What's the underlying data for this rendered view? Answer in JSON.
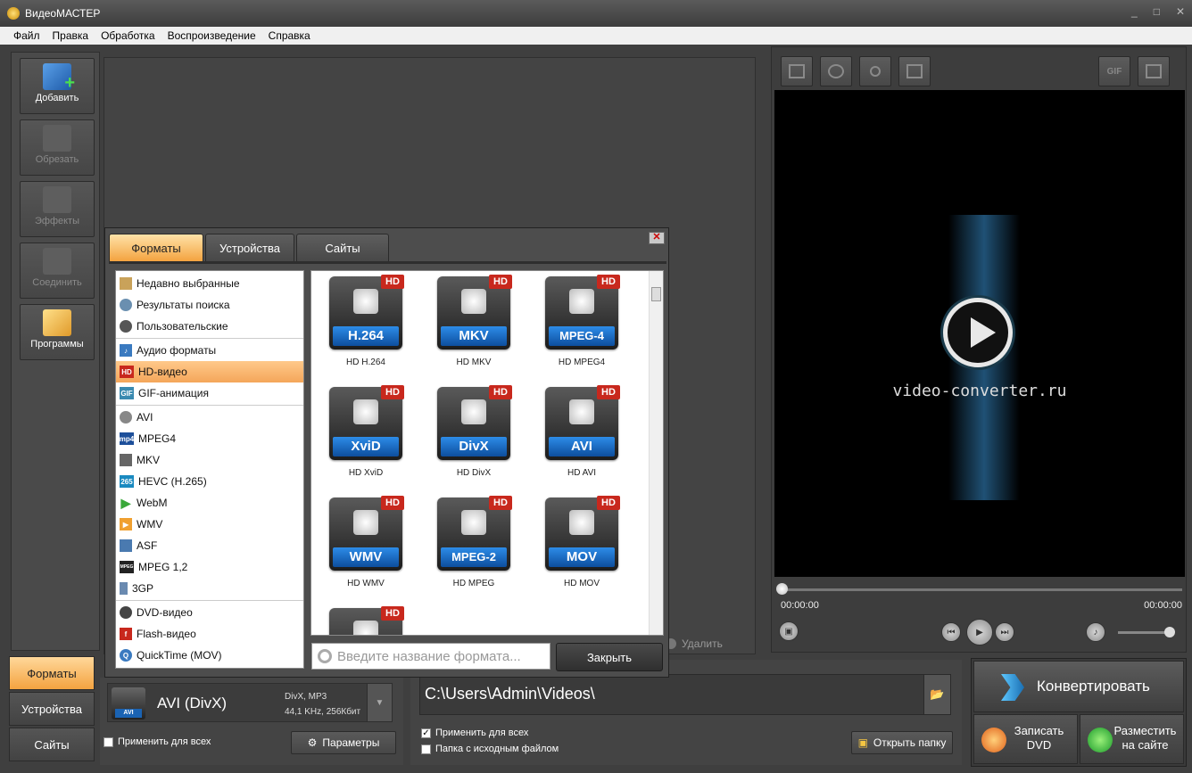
{
  "window": {
    "title": "ВидеоМАСТЕР",
    "min": "_",
    "max": "□",
    "close": "✕"
  },
  "menu": [
    "Файл",
    "Правка",
    "Обработка",
    "Воспроизведение",
    "Справка"
  ],
  "tools": [
    {
      "label": "Добавить",
      "icon": "film-add-icon"
    },
    {
      "label": "Обрезать",
      "icon": "scissors-icon"
    },
    {
      "label": "Эффекты",
      "icon": "effects-icon"
    },
    {
      "label": "Соединить",
      "icon": "join-icon"
    },
    {
      "label": "Программы",
      "icon": "programs-icon"
    }
  ],
  "workarea": {
    "delete_label": "Удалить"
  },
  "preview": {
    "gif_label": "GIF",
    "watermark": "video-converter.ru",
    "time_start": "00:00:00",
    "time_end": "00:00:00"
  },
  "bottom_tabs": [
    "Форматы",
    "Устройства",
    "Сайты"
  ],
  "format_panel": {
    "icon_label": "AVI",
    "name": "AVI (DivX)",
    "spec_line1": "DivX, MP3",
    "spec_line2": "44,1 KHz, 256Кбит",
    "apply_all": "Применить для всех",
    "params": "Параметры"
  },
  "output": {
    "path": "C:\\Users\\Admin\\Videos\\",
    "apply_all": "Применить для всех",
    "source_folder": "Папка с исходным файлом",
    "open_folder": "Открыть папку"
  },
  "convert": {
    "main": "Конвертировать",
    "dvd_line1": "Записать",
    "dvd_line2": "DVD",
    "site_line1": "Разместить",
    "site_line2": "на сайте"
  },
  "dialog": {
    "tabs": [
      "Форматы",
      "Устройства",
      "Сайты"
    ],
    "categories": [
      {
        "label": "Недавно выбранные",
        "icon": "recent-icon"
      },
      {
        "label": "Результаты поиска",
        "icon": "search-results-icon"
      },
      {
        "label": "Пользовательские",
        "icon": "user-icon"
      },
      {
        "label": "Аудио форматы",
        "icon": "audio-icon"
      },
      {
        "label": "HD-видео",
        "icon": "hd-icon",
        "badge": "HD"
      },
      {
        "label": "GIF-анимация",
        "icon": "gif-icon",
        "badge": "GIF"
      },
      {
        "label": "AVI",
        "icon": "avi-icon"
      },
      {
        "label": "MPEG4",
        "icon": "mp4-icon",
        "badge": "mp4"
      },
      {
        "label": "MKV",
        "icon": "mkv-icon"
      },
      {
        "label": "HEVC (H.265)",
        "icon": "hevc-icon",
        "badge": "265"
      },
      {
        "label": "WebM",
        "icon": "webm-icon"
      },
      {
        "label": "WMV",
        "icon": "wmv-icon"
      },
      {
        "label": "ASF",
        "icon": "asf-icon"
      },
      {
        "label": "MPEG 1,2",
        "icon": "mpeg-icon",
        "badge": "MPEG"
      },
      {
        "label": "3GP",
        "icon": "3gp-icon"
      },
      {
        "label": "DVD-видео",
        "icon": "dvd-icon"
      },
      {
        "label": "Flash-видео",
        "icon": "flash-icon"
      },
      {
        "label": "QuickTime (MOV)",
        "icon": "quicktime-icon"
      }
    ],
    "formats": [
      {
        "band": "H.264",
        "caption": "HD H.264"
      },
      {
        "band": "MKV",
        "caption": "HD MKV"
      },
      {
        "band": "MPEG-4",
        "caption": "HD MPEG4"
      },
      {
        "band": "XviD",
        "caption": "HD XviD"
      },
      {
        "band": "DivX",
        "caption": "HD DivX"
      },
      {
        "band": "AVI",
        "caption": "HD AVI"
      },
      {
        "band": "WMV",
        "caption": "HD WMV"
      },
      {
        "band": "MPEG-2",
        "caption": "HD MPEG"
      },
      {
        "band": "MOV",
        "caption": "HD MOV"
      },
      {
        "band": "",
        "caption": ""
      }
    ],
    "hd_badge": "HD",
    "search_placeholder": "Введите название формата...",
    "close_btn": "Закрыть"
  }
}
